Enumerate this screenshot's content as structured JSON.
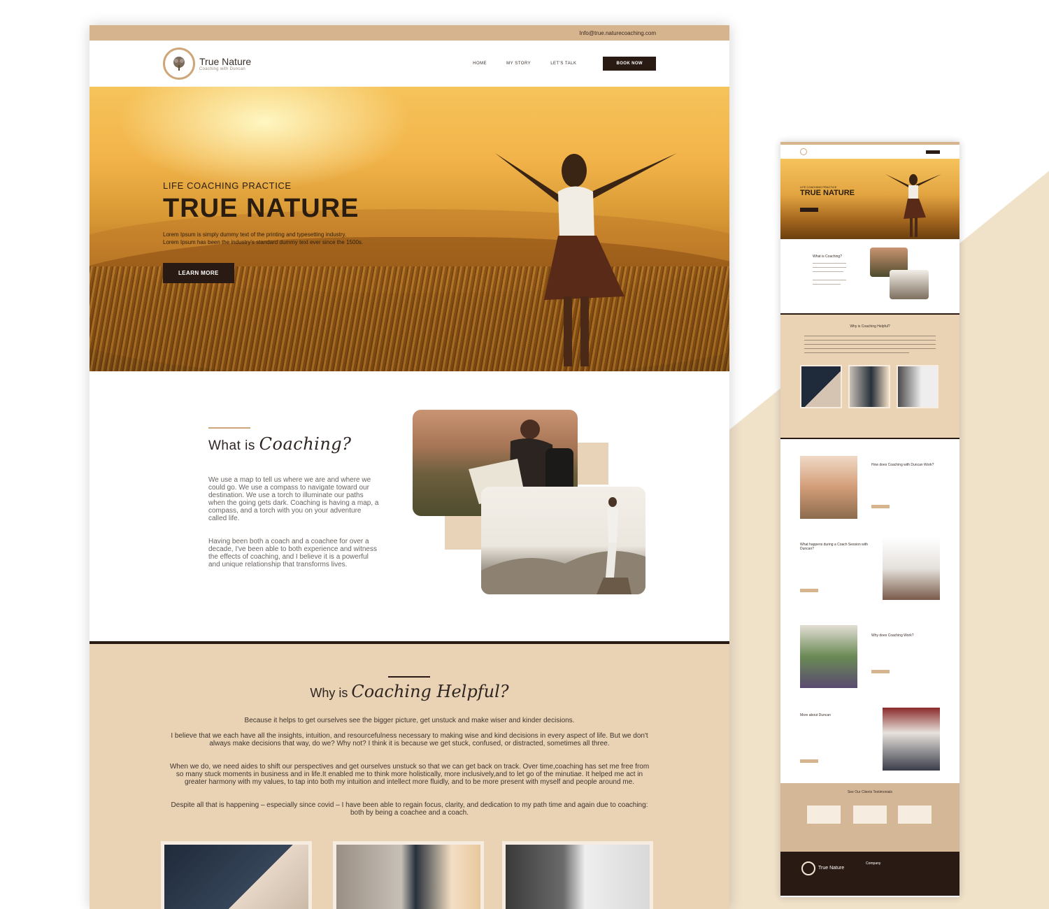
{
  "colors": {
    "accent_tan": "#d6b48e",
    "dark_brown": "#2a1a14",
    "beige_section": "#e9d3b4",
    "text_dark": "#2e2522"
  },
  "topbar": {
    "email": "Info@true.naturecoaching.com"
  },
  "brand": {
    "name": "True Nature",
    "tagline": "Coaching with Duncan",
    "logo_icon": "tree-icon"
  },
  "nav": {
    "items": [
      {
        "label": "HOME"
      },
      {
        "label": "MY STORY"
      },
      {
        "label": "LET'S TALK"
      }
    ],
    "cta": "BOOK NOW"
  },
  "hero": {
    "kicker": "LIFE COACHING PRACTICE",
    "title": "TRUE NATURE",
    "desc_1": "Lorem Ipsum is simply dummy text of the printing and typesetting industry.",
    "desc_2": "Lorem Ipsum has been the industry's standard dummy text ever since the 1500s.",
    "button": "LEARN MORE"
  },
  "what": {
    "heading_plain": "What is",
    "heading_script": "Coaching?",
    "para_1": "We use a map to tell us where we are and where we could go.  We use a compass to navigate toward our destination. We use a torch to illuminate our paths when the going gets dark.  Coaching is having a map, a compass, and a torch with you on your adventure called life.",
    "para_2": "Having been both a coach and a coachee for over a decade, I've been able to both experience and witness the effects of coaching, and I believe it is a powerful and unique relationship that transforms lives."
  },
  "why": {
    "heading_plain": "Why is",
    "heading_script": "Coaching Helpful?",
    "para_1": "Because it helps to get ourselves see the bigger picture, get unstuck and make wiser and kinder decisions.",
    "para_2": "I believe that we each have all the insights, intuition, and resourcefulness necessary to making wise and kind decisions in every aspect of life.  But we don't always make decisions that way, do we?  Why not? I think it is because we get stuck, confused, or distracted, sometimes all three.",
    "para_3": "When we do, we need aides to shift our perspectives and get ourselves unstuck so that we can get back on track. Over time,coaching has set me free from so many stuck moments in business and in life.It enabled me to think more holistically, more inclusively,and to let go of the minutiae. It helped me act in greater harmony with my values, to tap into both my intuition and intellect more fluidly, and to be more present with myself and people around me.",
    "para_4": "Despite all that is happening – especially since covid – I have been able to regain focus, clarity, and dedication to my path time and again due to coaching: both by being a coachee and a coach."
  },
  "mobile": {
    "kicker": "LIFE COACHING PRACTICE",
    "title": "TRUE NATURE",
    "what_heading": "What is Coaching?",
    "why_heading": "Why is Coaching Helpful?",
    "how_heading": "How does Coaching with Duncan Work?",
    "session_heading": "What happens during a Coach Session with Duncan?",
    "works_heading": "Why does Coaching Work?",
    "about_heading": "More about Duncan",
    "testimonials_heading": "See Our Clients Testimonials",
    "footer_brand": "True Nature",
    "footer_company": "Company"
  }
}
